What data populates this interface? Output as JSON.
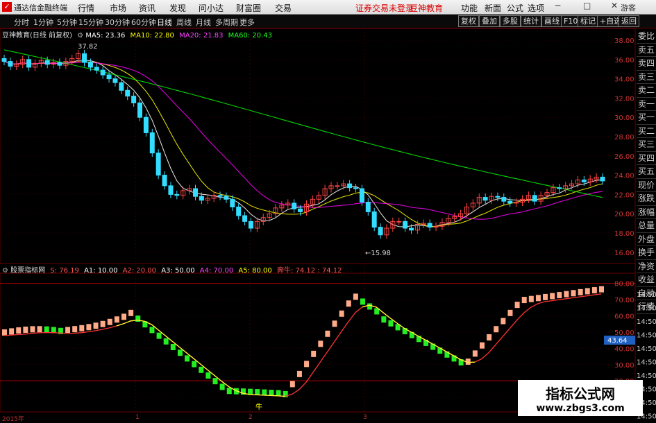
{
  "menubar": {
    "app_name": "通达信金融终端",
    "items": [
      "行情",
      "市场",
      "资讯",
      "发现",
      "问小达",
      "财富圈",
      "交易"
    ],
    "warning": "证券交易未登录",
    "brand": "豆神教育",
    "right_items": [
      "功能",
      "新面",
      "公式",
      "选项"
    ],
    "window_controls": [
      "─",
      "□",
      "✕"
    ]
  },
  "tabs": {
    "periods": [
      "分时",
      "1分钟",
      "5分钟",
      "15分钟",
      "30分钟",
      "60分钟",
      "日线",
      "周线",
      "月线",
      "多周期",
      "更多"
    ],
    "active": "日线",
    "right_buttons": [
      "复权",
      "叠加",
      "多股",
      "统计",
      "画线",
      "F10",
      "标记",
      "+自选",
      "返回"
    ],
    "guest": "游客"
  },
  "main_legend": {
    "title": "豆神教育(日线 前复权)",
    "ma5": "MA5: 23.36",
    "ma10": "MA10: 22.80",
    "ma20": "MA20: 21.83",
    "ma60": "MA60: 20.43",
    "ma5_color": "#ffffff",
    "ma10_color": "#ffff00",
    "ma20_color": "#ff00ff",
    "ma60_color": "#00ff00",
    "high_label": "37.82",
    "low_label": "←15.98"
  },
  "main_axis": {
    "labels": [
      "38.00",
      "36.00",
      "34.00",
      "32.00",
      "30.00",
      "28.00",
      "26.00",
      "24.00",
      "22.00",
      "20.00",
      "18.00",
      "16.00"
    ]
  },
  "indicator_legend": {
    "title": "股票指标网",
    "s": "S: 76.19",
    "a1": "A1: 10.00",
    "a2": "A2: 20.00",
    "a3": "A3: 50.00",
    "a4": "A4: 70.00",
    "a5": "A5: 80.00",
    "bull_label": "奔牛: 74.12",
    "bull_value": ": 74.12",
    "s_color": "#ff5555",
    "a1_color": "#ffffff",
    "a2_color": "#ff5555",
    "a3_color": "#ffffff",
    "a4_color": "#ff00ff",
    "a5_color": "#ffff00",
    "bull_color": "#ff5555"
  },
  "indicator_axis": {
    "labels": [
      "80.00",
      "70.00",
      "60.00",
      "50.00",
      "40.00",
      "30.00",
      "20.00",
      "10.00"
    ],
    "highlight": "43.64",
    "right_time": [
      "14:50",
      "14:50",
      "14:50",
      "14:50",
      "14:50",
      "14:50",
      "14:50",
      "14:50",
      "14:50",
      "14:50"
    ]
  },
  "indicator_marker": "牛",
  "sidebar": {
    "items": [
      "委比",
      "卖五",
      "卖四",
      "卖三",
      "卖二",
      "卖一",
      "买一",
      "买二",
      "买三",
      "买四",
      "买五",
      "现价",
      "涨跌",
      "涨幅",
      "总量",
      "外盘",
      "换手",
      "净资",
      "收益",
      "自动",
      "行情"
    ]
  },
  "dates": [
    "2015年",
    "1",
    "2",
    "3"
  ],
  "watermark": {
    "line1": "指标公式网",
    "line2": "www.zbgs3.com"
  }
}
